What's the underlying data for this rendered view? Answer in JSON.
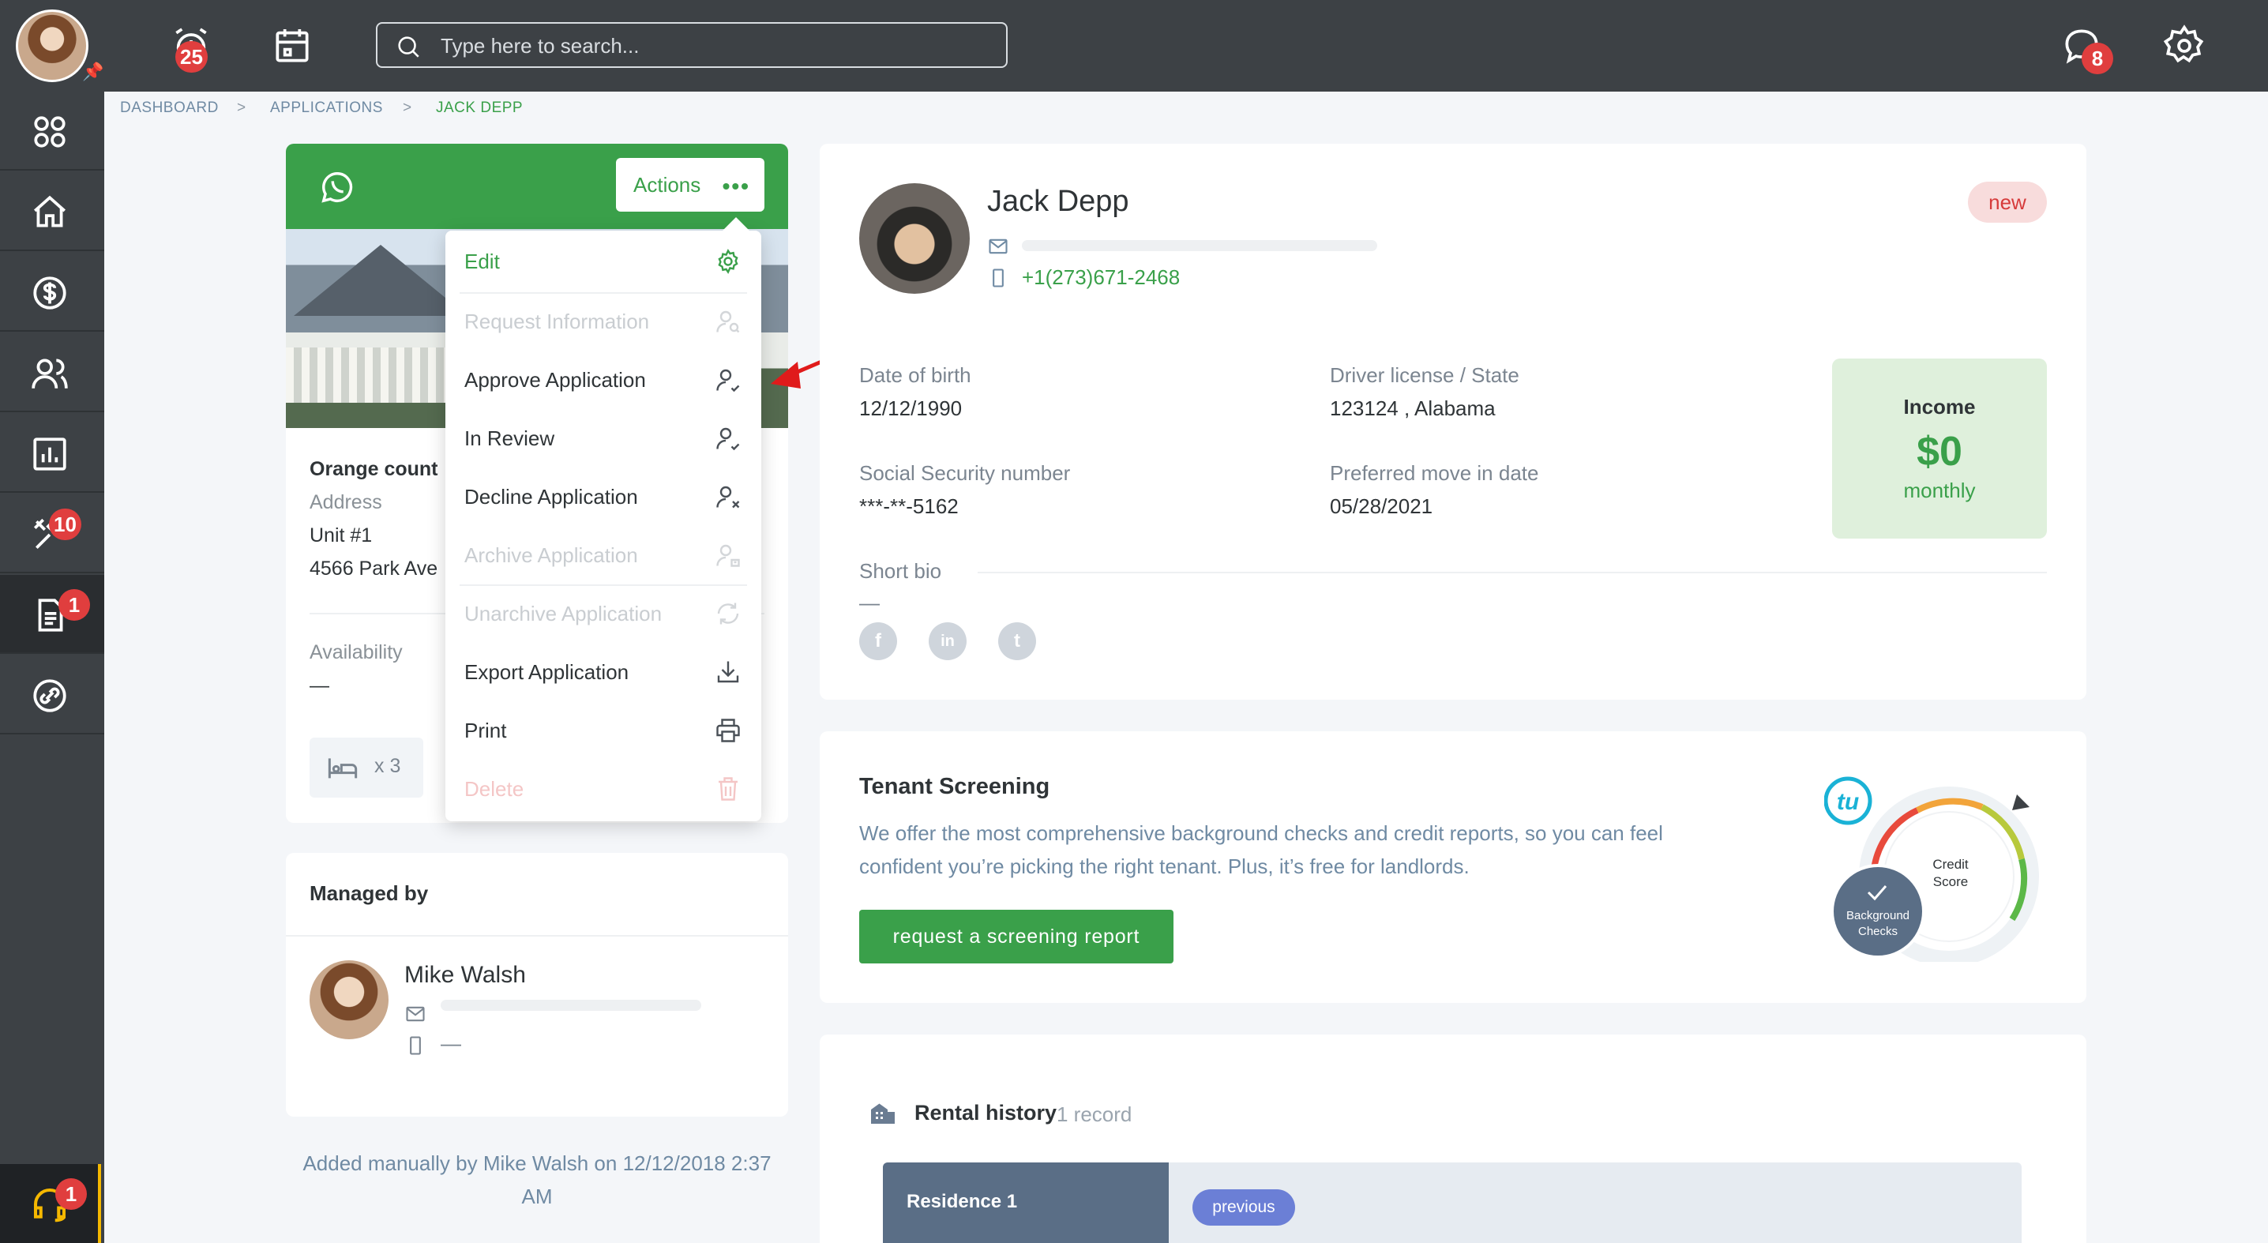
{
  "topbar": {
    "alarm_badge": "25",
    "search_placeholder": "Type here to search...",
    "chat_badge": "8"
  },
  "sidebar": {
    "tools_badge": "10",
    "applications_badge": "1",
    "help_badge": "1"
  },
  "breadcrumb": {
    "items": [
      "DASHBOARD",
      "APPLICATIONS",
      "JACK DEPP"
    ],
    "separator": ">"
  },
  "property_card": {
    "actions_label": "Actions",
    "property_title": "Orange count",
    "address_label": "Address",
    "unit": "Unit #1",
    "street": "4566 Park Ave",
    "availability_label": "Availability",
    "availability_value": "—",
    "beds": "x 3"
  },
  "actions_menu": {
    "items": [
      {
        "label": "Edit",
        "icon": "gear-icon",
        "state": "primary"
      },
      {
        "label": "Request Information",
        "icon": "user-search-icon",
        "state": "disabled"
      },
      {
        "label": "Approve Application",
        "icon": "user-check-icon",
        "state": "enabled"
      },
      {
        "label": "In Review",
        "icon": "user-check-icon",
        "state": "enabled"
      },
      {
        "label": "Decline Application",
        "icon": "user-x-icon",
        "state": "enabled"
      },
      {
        "label": "Archive Application",
        "icon": "user-archive-icon",
        "state": "disabled"
      },
      {
        "label": "Unarchive Application",
        "icon": "refresh-icon",
        "state": "disabled"
      },
      {
        "label": "Export Application",
        "icon": "download-icon",
        "state": "enabled"
      },
      {
        "label": "Print",
        "icon": "printer-icon",
        "state": "enabled"
      },
      {
        "label": "Delete",
        "icon": "trash-icon",
        "state": "danger-disabled"
      }
    ]
  },
  "managed_by": {
    "title": "Managed by",
    "name": "Mike Walsh",
    "phone": "—"
  },
  "added_note": "Added manually by Mike Walsh on 12/12/2018 2:37 AM",
  "profile": {
    "name": "Jack Depp",
    "phone": "+1(273)671-2468",
    "status": "new",
    "dob_label": "Date of birth",
    "dob_value": "12/12/1990",
    "license_label": "Driver license / State",
    "license_value": "123124 , Alabama",
    "ssn_label": "Social Security number",
    "ssn_value": "***-**-5162",
    "move_label": "Preferred move in date",
    "move_value": "05/28/2021",
    "bio_label": "Short bio",
    "bio_value": "—",
    "income_label": "Income",
    "income_amount": "$0",
    "income_period": "monthly",
    "social": [
      "f",
      "in",
      "t"
    ]
  },
  "screening": {
    "title": "Tenant Screening",
    "description": "We offer the most comprehensive background checks and credit reports, so you can feel confident you’re picking the right tenant. Plus, it’s free for landlords.",
    "button": "request a screening report",
    "logo_text": "tu",
    "credit_line1": "Credit",
    "credit_line2": "Score",
    "bg_line1": "Background",
    "bg_line2": "Checks"
  },
  "rental_history": {
    "title": "Rental history",
    "count": "1 record",
    "residence_label": "Residence 1",
    "residence_status": "previous"
  },
  "colors": {
    "brand_green": "#3aa04a",
    "nav_dark": "#3d4145",
    "badge_red": "#e03e3e"
  }
}
